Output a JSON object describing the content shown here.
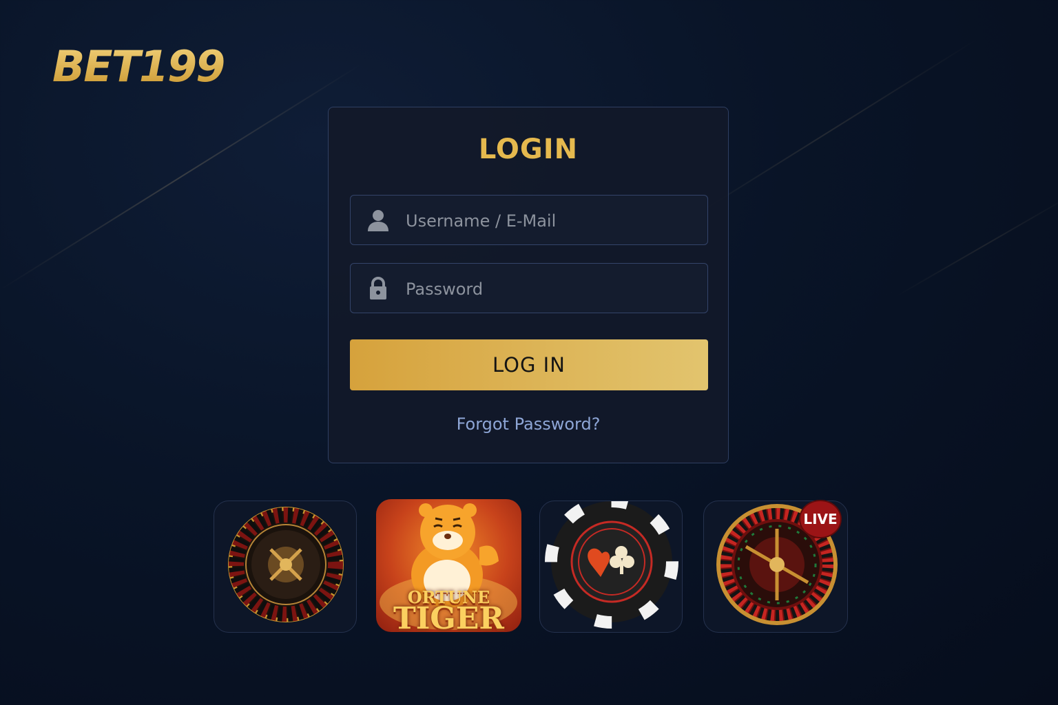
{
  "brand": {
    "logo_text": "BET199"
  },
  "login": {
    "title": "LOGIN",
    "username_placeholder": "Username / E-Mail",
    "password_placeholder": "Password",
    "submit_label": "LOG IN",
    "forgot_label": "Forgot Password?"
  },
  "games": [
    {
      "icon": "roulette-wheel-icon"
    },
    {
      "icon": "fortune-tiger-icon",
      "line1": "ORTUNE",
      "line2": "TIGER"
    },
    {
      "icon": "poker-chip-icon"
    },
    {
      "icon": "live-roulette-icon",
      "badge": "LIVE"
    }
  ],
  "colors": {
    "accent": "#e5b94e",
    "background": "#091427",
    "card": "#121929",
    "link": "#8ea6d6"
  }
}
